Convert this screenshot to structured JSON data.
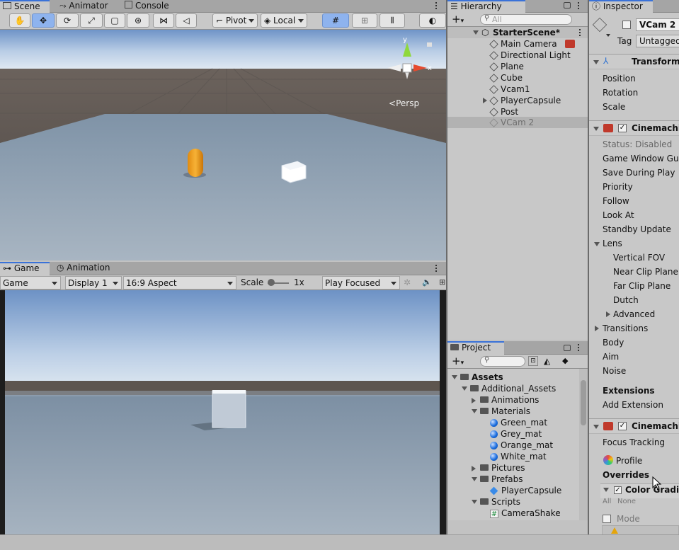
{
  "scene_panel": {
    "tabs": [
      "Scene",
      "Animator",
      "Console"
    ],
    "tools": {
      "pivot_label": "Pivot",
      "local_label": "Local"
    },
    "persp_label": "Persp",
    "gizmo_axes": {
      "y": "y",
      "x": "x"
    }
  },
  "game_panel": {
    "tabs": [
      "Game",
      "Animation"
    ],
    "display_dropdown": "Game",
    "display_select": "Display 1",
    "aspect_select": "16:9 Aspect",
    "scale_label": "Scale",
    "scale_value": "1x",
    "play_mode": "Play Focused"
  },
  "hierarchy": {
    "tab": "Hierarchy",
    "search_placeholder": "All",
    "scene_name": "StarterScene*",
    "items": [
      {
        "label": "Main Camera"
      },
      {
        "label": "Directional Light"
      },
      {
        "label": "Plane"
      },
      {
        "label": "Cube"
      },
      {
        "label": "Vcam1"
      },
      {
        "label": "PlayerCapsule"
      },
      {
        "label": "Post"
      },
      {
        "label": "VCam 2"
      }
    ]
  },
  "project": {
    "tab": "Project",
    "tree": [
      {
        "label": "Assets",
        "depth": 0,
        "icon": "folder-icon",
        "open": true
      },
      {
        "label": "Additional_Assets",
        "depth": 1,
        "icon": "folder-icon",
        "open": true
      },
      {
        "label": "Animations",
        "depth": 2,
        "icon": "folder-icon",
        "open": false
      },
      {
        "label": "Materials",
        "depth": 2,
        "icon": "folder-icon",
        "open": true
      },
      {
        "label": "Green_mat",
        "depth": 3,
        "icon": "material-icon"
      },
      {
        "label": "Grey_mat",
        "depth": 3,
        "icon": "material-icon"
      },
      {
        "label": "Orange_mat",
        "depth": 3,
        "icon": "material-icon"
      },
      {
        "label": "White_mat",
        "depth": 3,
        "icon": "material-icon"
      },
      {
        "label": "Pictures",
        "depth": 2,
        "icon": "folder-icon",
        "open": false
      },
      {
        "label": "Prefabs",
        "depth": 2,
        "icon": "folder-icon",
        "open": true
      },
      {
        "label": "PlayerCapsule",
        "depth": 3,
        "icon": "prefab-icon"
      },
      {
        "label": "Scripts",
        "depth": 2,
        "icon": "folder-icon",
        "open": true
      },
      {
        "label": "CameraShake",
        "depth": 3,
        "icon": "script-icon"
      }
    ]
  },
  "inspector": {
    "tab": "Inspector",
    "object_name": "VCam 2",
    "tag_label": "Tag",
    "tag_value": "Untagged",
    "transform_header": "Transform",
    "transform_rows": [
      "Position",
      "Rotation",
      "Scale"
    ],
    "cinemachine_header": "Cinemachin",
    "status": "Status: Disabled",
    "cm_rows": [
      "Game Window Guid",
      "Save During Play",
      "Priority",
      "Follow",
      "Look At",
      "Standby Update"
    ],
    "lens_label": "Lens",
    "lens_rows": [
      "Vertical FOV",
      "Near Clip Plane",
      "Far Clip Plane",
      "Dutch"
    ],
    "advanced_label": "Advanced",
    "transitions_label": "Transitions",
    "pipeline_rows": [
      "Body",
      "Aim",
      "Noise"
    ],
    "extensions_label": "Extensions",
    "add_extension_label": "Add Extension",
    "cinemachine2_header": "Cinemachin",
    "focus_tracking": "Focus Tracking",
    "profile_label": "Profile",
    "overrides_label": "Overrides",
    "color_grading_label": "Color Grading",
    "all_label": "All",
    "none_label": "None",
    "mode_label": "Mode"
  }
}
